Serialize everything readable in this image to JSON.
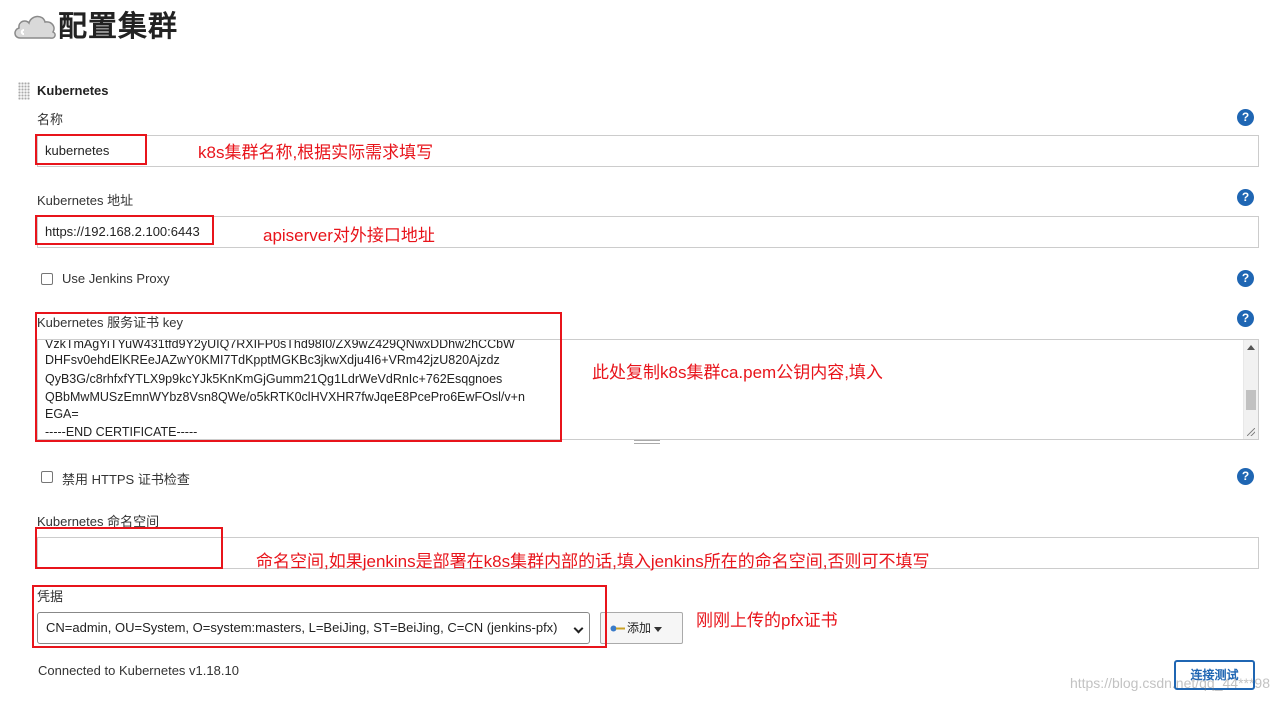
{
  "page": {
    "title": "配置集群"
  },
  "section": {
    "title": "Kubernetes"
  },
  "fields": {
    "name": {
      "label": "名称",
      "value": "kubernetes"
    },
    "url": {
      "label": "Kubernetes 地址",
      "value": "https://192.168.2.100:6443"
    },
    "proxy": {
      "label": "Use Jenkins Proxy"
    },
    "cert": {
      "label": "Kubernetes 服务证书 key",
      "lines": [
        "VzkTmAgYiTYuW431tfd9Y2yUIQ7RXIFP0sThd98I0/ZX9wZ429QNwxDDhw2hCCbW",
        "DHFsv0ehdElKREeJAZwY0KMI7TdKpptMGKBc3jkwXdju4I6+VRm42jzU820Ajzdz",
        "QyB3G/c8rhfxfYTLX9p9kcYJk5KnKmGjGumm21Qg1LdrWeVdRnIc+762Esqgnoes",
        "QBbMwMUSzEmnWYbz8Vsn8QWe/o5kRTK0clHVXHR7fwJqeE8PcePro6EwFOsl/v+n",
        "EGA=",
        "-----END CERTIFICATE-----"
      ]
    },
    "https_check": {
      "label": "禁用 HTTPS 证书检查"
    },
    "namespace": {
      "label": "Kubernetes 命名空间",
      "value": ""
    },
    "credentials": {
      "label": "凭据",
      "selected": "CN=admin, OU=System, O=system:masters, L=BeiJing, ST=BeiJing, C=CN (jenkins-pfx)"
    }
  },
  "buttons": {
    "add": "添加",
    "test": "连接测试"
  },
  "status": {
    "text": "Connected to Kubernetes v1.18.10"
  },
  "help_icon": "?",
  "annotations": {
    "name": "k8s集群名称,根据实际需求填写",
    "url": "apiserver对外接口地址",
    "cert": "此处复制k8s集群ca.pem公钥内容,填入",
    "namespace": "命名空间,如果jenkins是部署在k8s集群内部的话,填入jenkins所在的命名空间,否则可不填写",
    "credentials": "刚刚上传的pfx证书"
  },
  "watermark": "https://blog.csdn.net/qq_44***98",
  "colors": {
    "annotation": "#e8141b",
    "accent": "#1f66b3"
  }
}
